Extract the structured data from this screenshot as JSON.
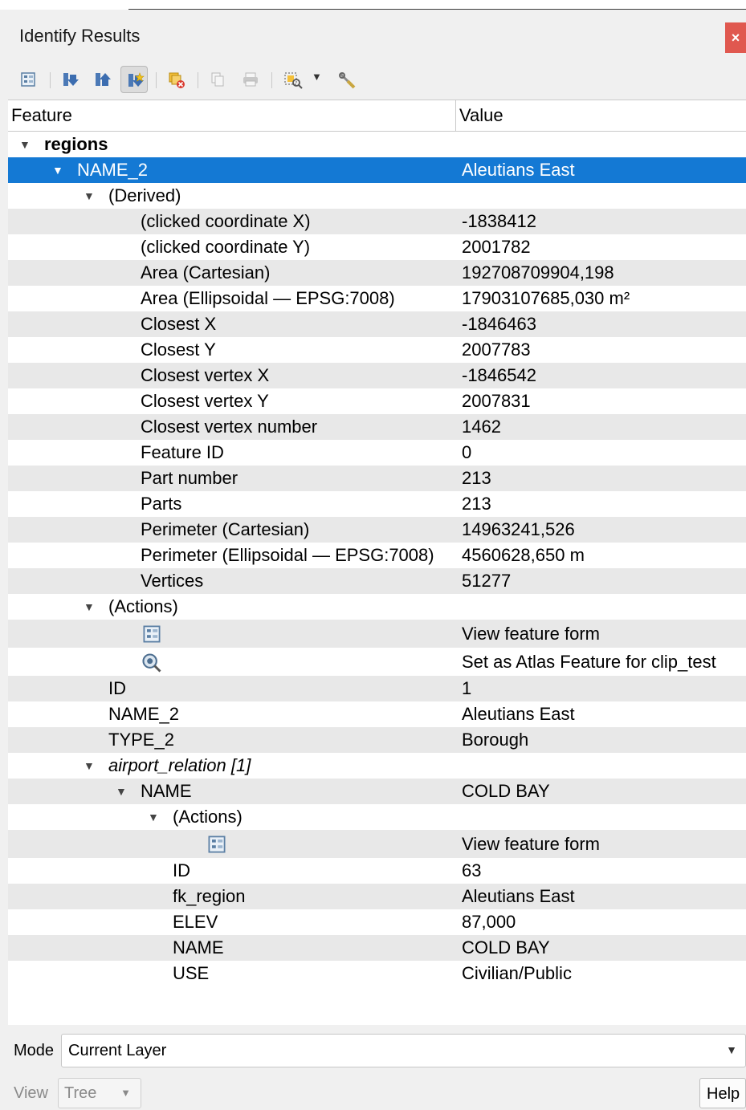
{
  "window": {
    "title": "Identify Results",
    "close_glyph": "×"
  },
  "toolbar": {
    "buttons": [
      {
        "name": "feature-form-icon",
        "state": "normal"
      },
      {
        "name": "expand-all-icon",
        "state": "normal"
      },
      {
        "name": "collapse-all-icon",
        "state": "normal"
      },
      {
        "name": "expand-new-results-icon",
        "state": "active"
      },
      {
        "name": "clear-results-icon",
        "state": "normal"
      },
      {
        "name": "copy-feature-icon",
        "state": "disabled"
      },
      {
        "name": "print-icon",
        "state": "disabled"
      },
      {
        "name": "select-features-icon",
        "state": "normal"
      },
      {
        "name": "identify-settings-icon",
        "state": "normal"
      }
    ]
  },
  "tree": {
    "headers": {
      "feature": "Feature",
      "value": "Value"
    },
    "rows": [
      {
        "feature": "regions",
        "value": "",
        "arrow": "▼",
        "bold": true
      },
      {
        "feature": "NAME_2",
        "value": "Aleutians East",
        "arrow": "▼",
        "selected": true
      },
      {
        "feature": "(Derived)",
        "value": "",
        "arrow": "▼"
      },
      {
        "feature": "(clicked coordinate X)",
        "value": "-1838412"
      },
      {
        "feature": "(clicked coordinate Y)",
        "value": "2001782"
      },
      {
        "feature": "Area (Cartesian)",
        "value": "192708709904,198"
      },
      {
        "feature": "Area (Ellipsoidal — EPSG:7008)",
        "value": "17903107685,030 m²"
      },
      {
        "feature": "Closest X",
        "value": "-1846463"
      },
      {
        "feature": "Closest Y",
        "value": "2007783"
      },
      {
        "feature": "Closest vertex X",
        "value": "-1846542"
      },
      {
        "feature": "Closest vertex Y",
        "value": "2007831"
      },
      {
        "feature": "Closest vertex number",
        "value": "1462"
      },
      {
        "feature": "Feature ID",
        "value": "0"
      },
      {
        "feature": "Part number",
        "value": "213"
      },
      {
        "feature": "Parts",
        "value": "213"
      },
      {
        "feature": "Perimeter (Cartesian)",
        "value": "14963241,526"
      },
      {
        "feature": "Perimeter (Ellipsoidal — EPSG:7008)",
        "value": "4560628,650 m"
      },
      {
        "feature": "Vertices",
        "value": "51277"
      },
      {
        "feature": "(Actions)",
        "value": "",
        "arrow": "▼"
      },
      {
        "icon": "feature-form-icon",
        "value": "View feature form"
      },
      {
        "icon": "atlas-feature-icon",
        "value": "Set as Atlas Feature for clip_test"
      },
      {
        "feature": "ID",
        "value": "1"
      },
      {
        "feature": "NAME_2",
        "value": "Aleutians East"
      },
      {
        "feature": "TYPE_2",
        "value": "Borough"
      },
      {
        "feature": "airport_relation [1]",
        "value": "",
        "arrow": "▼",
        "italic": true
      },
      {
        "feature": "NAME",
        "value": "COLD BAY",
        "arrow": "▼"
      },
      {
        "feature": "(Actions)",
        "value": "",
        "arrow": "▼"
      },
      {
        "icon": "feature-form-icon",
        "value": "View feature form"
      },
      {
        "feature": "ID",
        "value": "63"
      },
      {
        "feature": "fk_region",
        "value": "Aleutians East"
      },
      {
        "feature": "ELEV",
        "value": "87,000"
      },
      {
        "feature": "NAME",
        "value": "COLD BAY"
      },
      {
        "feature": "USE",
        "value": "Civilian/Public"
      }
    ]
  },
  "mode": {
    "label": "Mode",
    "value": "Current Layer"
  },
  "view": {
    "label": "View",
    "value": "Tree"
  },
  "help": {
    "label": "Help"
  },
  "colors": {
    "selection": "#1479d4",
    "alt_row": "#e8e8e8",
    "close": "#e0584f"
  }
}
